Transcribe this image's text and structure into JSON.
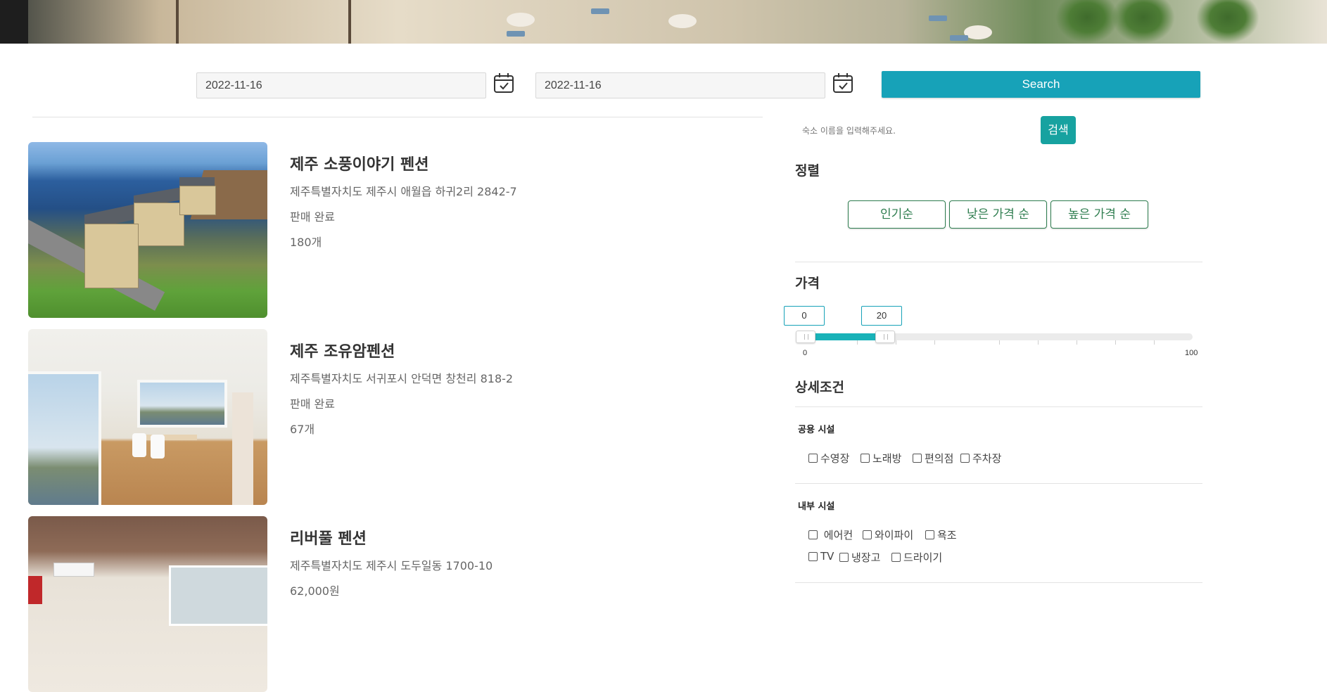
{
  "dates": {
    "checkin": "2022-11-16",
    "checkout": "2022-11-16"
  },
  "search_button": "Search",
  "listings": [
    {
      "name": "제주 소풍이야기 펜션",
      "address": "제주특별자치도 제주시 애월읍 하귀2리 2842-7",
      "status": "판매 완료",
      "count": "180개"
    },
    {
      "name": "제주 조유암펜션",
      "address": "제주특별자치도 서귀포시 안덕면 창천리 818-2",
      "status": "판매 완료",
      "count": "67개"
    },
    {
      "name": "리버풀 펜션",
      "address": "제주특별자치도 제주시 도두일동 1700-10",
      "price": "62,000원"
    }
  ],
  "sidebar": {
    "search_placeholder": "숙소 이름을 입력해주세요.",
    "search_button": "검색",
    "sort": {
      "title": "정렬",
      "options": [
        "인기순",
        "낮은 가격 순",
        "높은 가격 순"
      ]
    },
    "price": {
      "title": "가격",
      "min_value": "0",
      "max_value": "20",
      "scale_min": "0",
      "scale_max": "100",
      "range_min_percent": 0,
      "range_max_percent": 20
    },
    "details": {
      "title": "상세조건",
      "groups": [
        {
          "title": "공용 시설",
          "options": [
            "수영장",
            "노래방",
            "편의점",
            "주차장"
          ]
        },
        {
          "title": "내부 시설",
          "options": [
            "에어컨",
            "와이파이",
            "욕조",
            "TV",
            "냉장고",
            "드라이기"
          ]
        }
      ]
    }
  },
  "colors": {
    "primary": "#17a2b8",
    "sort_border": "#2e7d4f",
    "search_small": "#17a2a0"
  },
  "icons": {
    "calendar": "calendar-check-icon"
  }
}
